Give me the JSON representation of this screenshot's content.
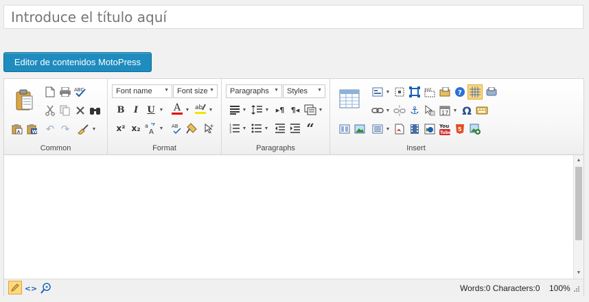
{
  "title_input": {
    "placeholder": "Introduce el título aquí"
  },
  "motopress_button": {
    "label": "Editor de contenidos MotoPress"
  },
  "toolbar": {
    "groups": {
      "common": "Common",
      "format": "Format",
      "paragraphs": "Paragraphs",
      "insert": "Insert"
    },
    "selects": {
      "font_name": "Font name",
      "font_size": "Font size",
      "paragraphs": "Paragraphs",
      "styles": "Styles"
    },
    "format_buttons": {
      "bold": "B",
      "italic": "I",
      "underline": "U",
      "font_color": "A"
    },
    "icons": [
      "paste-icon",
      "new-document-icon",
      "print-icon",
      "spellcheck-icon",
      "cut-icon",
      "copy-icon",
      "delete-icon",
      "find-icon",
      "paste-text-icon",
      "paste-word-icon",
      "undo-icon",
      "redo-icon",
      "clean-format-icon",
      "bold-icon",
      "italic-icon",
      "underline-icon",
      "font-color-icon",
      "highlight-icon",
      "superscript-icon",
      "subscript-icon",
      "case-icon",
      "abbreviation-icon",
      "format-painter-icon",
      "select-icon",
      "align-justify-icon",
      "line-height-icon",
      "ltr-icon",
      "rtl-icon",
      "indent-icon",
      "ordered-list-icon",
      "unordered-list-icon",
      "outdent-icon",
      "increase-indent-icon",
      "blockquote-icon",
      "table-icon",
      "form-icon",
      "box-icon",
      "square-icon",
      "template-icon",
      "insert-image-icon",
      "help-icon",
      "grid-icon",
      "preview-icon",
      "link-icon",
      "unlink-icon",
      "anchor-icon",
      "cursor-icon",
      "date-icon",
      "omega-icon",
      "keyboard-icon",
      "layout-icon",
      "image-icon",
      "list-box-icon",
      "pdf-icon",
      "film-icon",
      "flash-icon",
      "youtube-icon",
      "html5-icon",
      "add-image-icon"
    ]
  },
  "status_bar": {
    "words": "Words:0 Characters:0",
    "zoom": "100%"
  },
  "colors": {
    "accent": "#1e8cbe",
    "font_color_bar": "#e00000",
    "highlight_bar": "#f5e300"
  }
}
